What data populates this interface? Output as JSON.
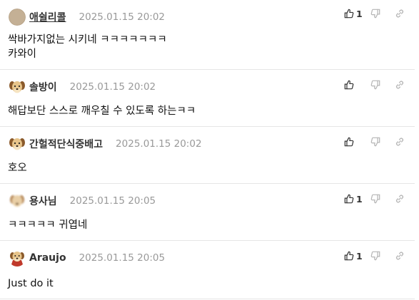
{
  "comments": [
    {
      "author": "애쉴리콜",
      "timestamp": "2025.01.15 20:02",
      "text": "싹바가지없는 시키네 ㅋㅋㅋㅋㅋㅋㅋ\n카와이",
      "likes": "1",
      "avatar": "plain-avatar-icon",
      "author_linked": true
    },
    {
      "author": "솔방이",
      "timestamp": "2025.01.15 20:02",
      "text": "해답보단 스스로 깨우칠 수 있도록 하는ㅋㅋ",
      "likes": "",
      "avatar": "puppy-avatar-icon"
    },
    {
      "author": "간헐적단식중배고",
      "timestamp": "2025.01.15 20:02",
      "text": "호오",
      "likes": "",
      "avatar": "puppy-avatar-icon"
    },
    {
      "author": "용사님",
      "timestamp": "2025.01.15 20:05",
      "text": "ㅋㅋㅋㅋㅋ 귀엽네",
      "likes": "1",
      "avatar": "blurred-puppy-avatar-icon"
    },
    {
      "author": "Araujo",
      "timestamp": "2025.01.15 20:05",
      "text": "Just do it",
      "likes": "1",
      "avatar": "puppy-cape-avatar-icon"
    }
  ],
  "colors": {
    "divider": "#e6e6e6",
    "timestamp": "#999999",
    "icon": "#b5b5b5",
    "like_icon": "#333333"
  }
}
